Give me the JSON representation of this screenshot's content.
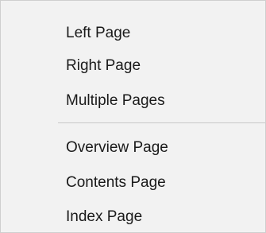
{
  "menu": {
    "group1": [
      {
        "label": "Left Page"
      },
      {
        "label": "Right Page"
      },
      {
        "label": "Multiple Pages"
      }
    ],
    "group2": [
      {
        "label": "Overview Page"
      },
      {
        "label": "Contents Page"
      },
      {
        "label": "Index Page"
      }
    ]
  }
}
